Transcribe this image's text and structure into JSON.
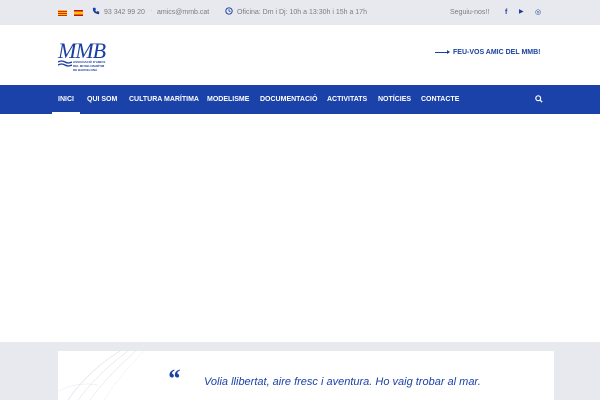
{
  "topbar": {
    "phone": "93 342 99 20",
    "email": "amics@mmb.cat",
    "hours": "Oficina: Dm i Dj: 10h a 13:30h i 15h a 17h",
    "follow_label": "Seguiu-nos!!",
    "social": [
      {
        "icon": "facebook-icon",
        "glyph": "f"
      },
      {
        "icon": "youtube-icon",
        "glyph": "▶"
      },
      {
        "icon": "instagram-icon",
        "glyph": "◎"
      }
    ]
  },
  "header": {
    "logo_text": "MMB",
    "logo_sub_lines": [
      "ASSOCIACIÓ D'AMICS",
      "DEL MUSEU MARÍTIM",
      "DE BARCELONA"
    ],
    "cta_label": "FEU-VOS AMIC DEL MMB!"
  },
  "nav": {
    "items": [
      {
        "label": "INICI",
        "active": true
      },
      {
        "label": "QUI SOM"
      },
      {
        "label": "CULTURA MARÍTIMA"
      },
      {
        "label": "MODELISME"
      },
      {
        "label": "DOCUMENTACIÓ"
      },
      {
        "label": "ACTIVITATS"
      },
      {
        "label": "NOTÍCIES"
      },
      {
        "label": "CONTACTE"
      }
    ]
  },
  "quote": {
    "mark": "“",
    "text": "Volia llibertat, aire fresc i aventura. Ho vaig trobar al mar."
  },
  "colors": {
    "brand": "#1a42a8",
    "topbar_bg": "#e8e9ee",
    "muted_text": "#7a7d86"
  }
}
